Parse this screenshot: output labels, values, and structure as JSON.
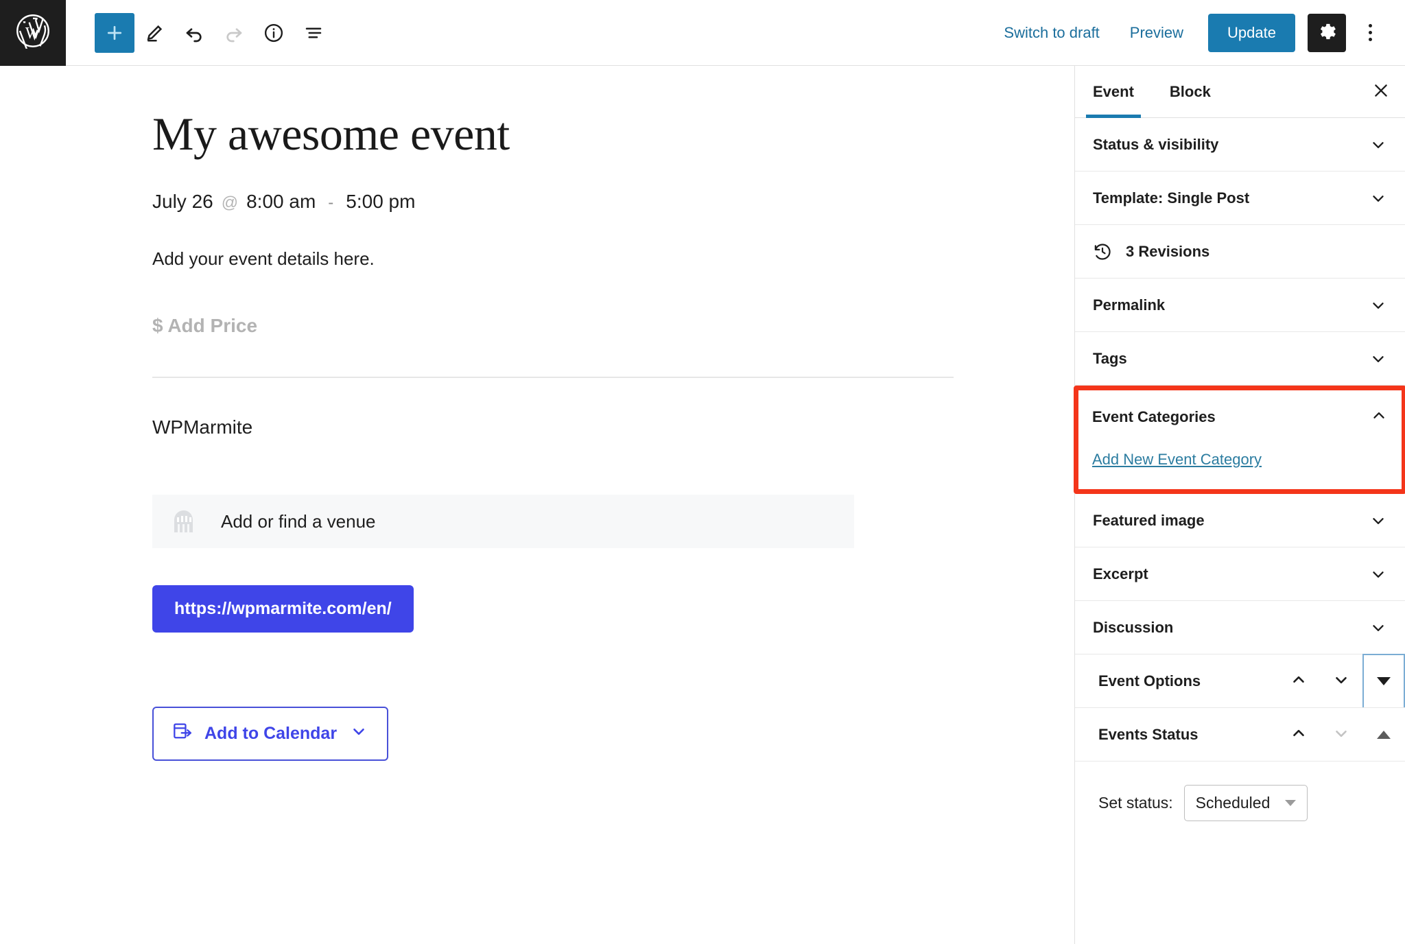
{
  "topbar": {
    "logo_icon": "wordpress-logo-icon",
    "tools": [
      {
        "name": "add-block-button",
        "icon": "plus-icon",
        "primary": true
      },
      {
        "name": "edit-tool-button",
        "icon": "pencil-icon",
        "primary": false
      },
      {
        "name": "undo-button",
        "icon": "undo-arrow-icon",
        "primary": false
      },
      {
        "name": "redo-button",
        "icon": "redo-arrow-icon",
        "primary": false
      },
      {
        "name": "details-button",
        "icon": "info-circle-icon",
        "primary": false
      },
      {
        "name": "list-view-button",
        "icon": "list-view-icon",
        "primary": false
      }
    ],
    "switch_to_draft": "Switch to draft",
    "preview": "Preview",
    "update": "Update",
    "settings_icon": "gear-icon",
    "options_icon": "kebab-menu-icon",
    "accent": "#1a7bb0"
  },
  "editor": {
    "title": "My awesome event",
    "date": "July 26",
    "at_symbol": "@",
    "start_time": "8:00 am",
    "dash": "-",
    "end_time": "5:00 pm",
    "body_text": "Add your event details here.",
    "add_price": "$ Add Price",
    "organizer": "WPMarmite",
    "venue_placeholder": "Add or find a venue",
    "venue_icon": "venue-building-icon",
    "website_url": "https://wpmarmite.com/en/",
    "website_color": "#3f45e8",
    "calendar_button": "Add to Calendar",
    "calendar_icon": "calendar-export-icon",
    "calendar_color": "#3f45e8"
  },
  "sidebar": {
    "tabs": [
      {
        "label": "Event",
        "active": true
      },
      {
        "label": "Block",
        "active": false
      }
    ],
    "close_icon": "close-icon",
    "panels": [
      {
        "label": "Status & visibility",
        "chevron": "chevron-down-icon"
      },
      {
        "label": "Template: Single Post",
        "chevron": "chevron-down-icon"
      },
      {
        "label": "3 Revisions",
        "chevron": "none",
        "icon": "revisions-clock-icon"
      },
      {
        "label": "Permalink",
        "chevron": "chevron-down-icon"
      },
      {
        "label": "Tags",
        "chevron": "chevron-down-icon"
      }
    ],
    "highlighted_panel": {
      "label": "Event Categories",
      "chevron": "chevron-up-icon",
      "add_link": "Add New Event Category",
      "highlight_color": "#f4351a",
      "link_color": "#2b7ca0"
    },
    "panels_after": [
      {
        "label": "Featured image",
        "chevron": "chevron-down-icon"
      },
      {
        "label": "Excerpt",
        "chevron": "chevron-down-icon"
      },
      {
        "label": "Discussion",
        "chevron": "chevron-down-icon"
      }
    ],
    "metaboxes": [
      {
        "label": "Event Options",
        "up_icon": "chevron-up-icon",
        "down_icon": "chevron-down-icon",
        "toggle_icon": "caret-down-icon",
        "toggle_focused": true
      },
      {
        "label": "Events Status",
        "up_icon": "chevron-up-icon",
        "down_icon": "chevron-down-icon-disabled",
        "toggle_icon": "caret-up-icon",
        "toggle_focused": false
      }
    ],
    "events_status": {
      "set_status_label": "Set status:",
      "selected_value": "Scheduled",
      "dropdown_icon": "caret-down-icon"
    }
  }
}
